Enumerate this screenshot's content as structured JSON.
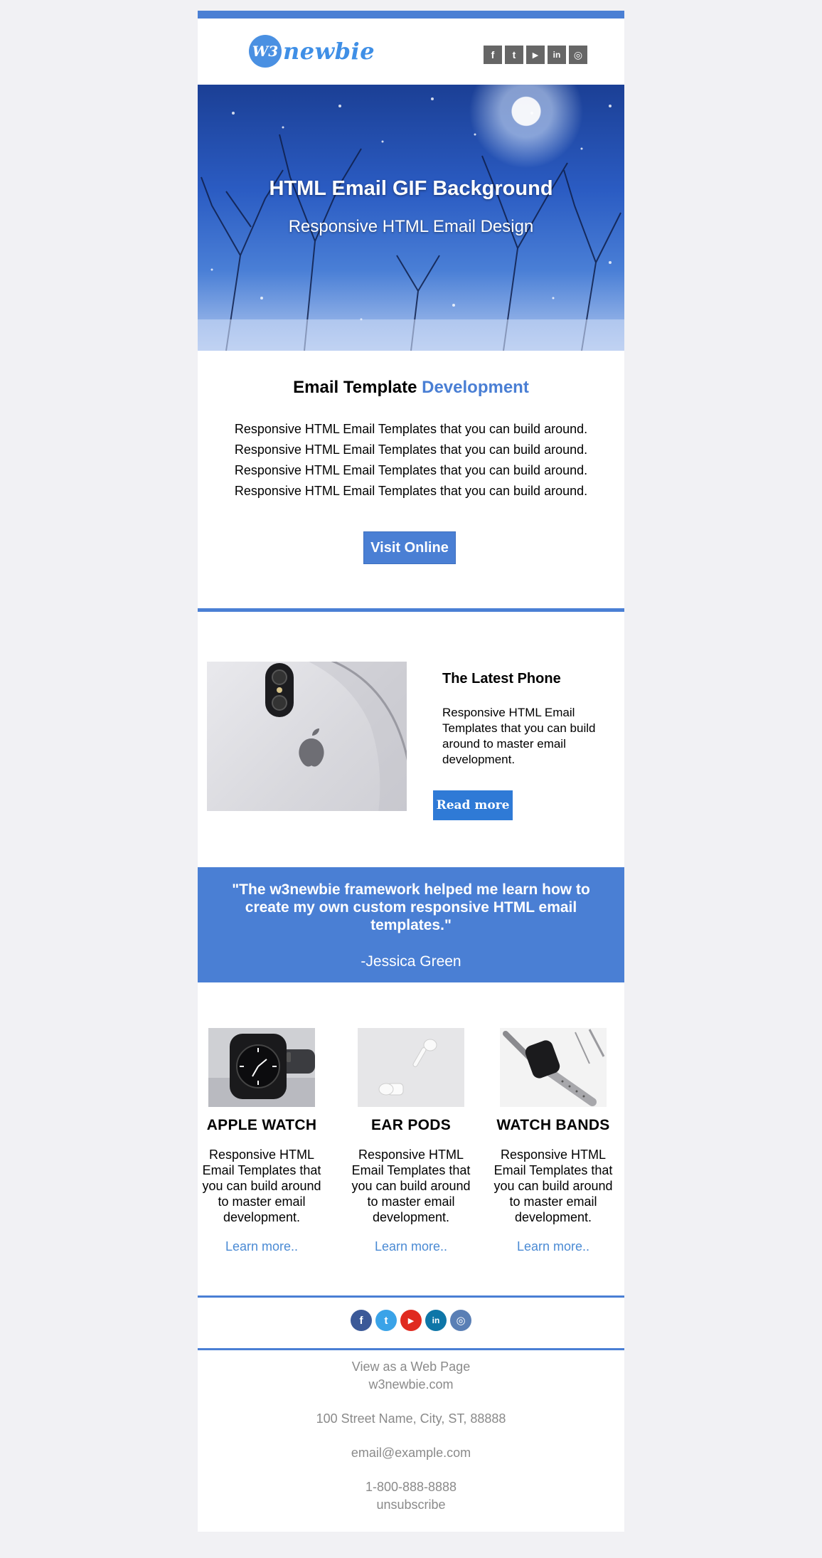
{
  "colors": {
    "accent": "#4a7fd4",
    "background": "#f1f1f4",
    "link": "#4a8ad4",
    "footer_text": "#8a8a8a"
  },
  "header": {
    "logo_badge": "W3",
    "logo_word": "newbie",
    "social": [
      {
        "name": "facebook-icon",
        "glyph": "f"
      },
      {
        "name": "twitter-icon",
        "glyph": "t"
      },
      {
        "name": "youtube-icon",
        "glyph": "▶"
      },
      {
        "name": "linkedin-icon",
        "glyph": "in"
      },
      {
        "name": "instagram-icon",
        "glyph": "◎"
      }
    ]
  },
  "hero": {
    "title": "HTML Email GIF Background",
    "subtitle": "Responsive HTML Email Design"
  },
  "intro": {
    "heading_plain": "Email Template ",
    "heading_accent": "Development",
    "lines": [
      "Responsive HTML Email Templates that you can build around.",
      "Responsive HTML Email Templates that you can build around.",
      "Responsive HTML Email Templates that you can build around.",
      "Responsive HTML Email Templates that you can build around."
    ],
    "button": "Visit Online"
  },
  "feature": {
    "title": "The Latest Phone",
    "description": "Responsive HTML Email Templates that you can build around to master email development.",
    "button": "Read more"
  },
  "testimonial": {
    "quote": "\"The w3newbie framework helped me learn how to create my own custom responsive HTML email templates.\"",
    "author": "-Jessica Green"
  },
  "products": [
    {
      "title": "APPLE WATCH",
      "description": "Responsive HTML Email Templates that you can build around to master email development.",
      "link": "Learn more.."
    },
    {
      "title": "EAR PODS",
      "description": "Responsive HTML Email Templates that you can build around to master email development.",
      "link": "Learn more.."
    },
    {
      "title": "WATCH BANDS",
      "description": "Responsive HTML Email Templates that you can build around to master email development.",
      "link": "Learn more.."
    }
  ],
  "footer_social": [
    {
      "name": "facebook-icon",
      "glyph": "f",
      "color": "#3b5998"
    },
    {
      "name": "twitter-icon",
      "glyph": "t",
      "color": "#3aa3e8"
    },
    {
      "name": "youtube-icon",
      "glyph": "▶",
      "color": "#e02a20"
    },
    {
      "name": "linkedin-icon",
      "glyph": "in",
      "color": "#0e76a8"
    },
    {
      "name": "instagram-icon",
      "glyph": "◎",
      "color": "#5a7fb5"
    }
  ],
  "footer": {
    "view_web": "View as a Web Page",
    "site": "w3newbie.com",
    "address": "100 Street Name, City, ST, 88888",
    "email": "email@example.com",
    "phone": "1-800-888-8888",
    "unsubscribe": "unsubscribe"
  }
}
